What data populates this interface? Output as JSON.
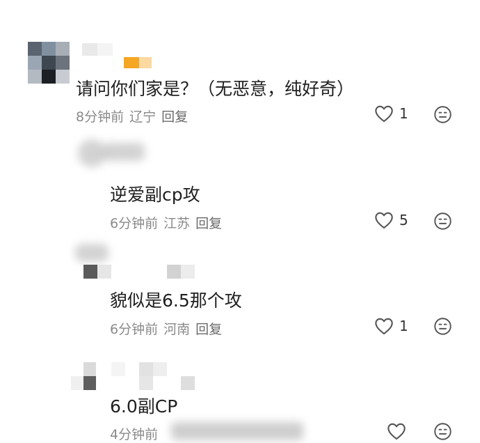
{
  "comments": [
    {
      "content": "请问你们家是？（无恶意，纯好奇）",
      "time": "8分钟前",
      "location": "辽宁",
      "reply_label": "回复",
      "likes": "1"
    },
    {
      "content": "逆爱副cp攻",
      "time": "6分钟前",
      "location": "江苏",
      "reply_label": "回复",
      "likes": "5"
    },
    {
      "content": "貌似是6.5那个攻",
      "time": "6分钟前",
      "location": "河南",
      "reply_label": "回复",
      "likes": "1"
    },
    {
      "content": "6.0副CP",
      "time": "4分钟前",
      "location": "",
      "reply_label": "",
      "likes": ""
    }
  ],
  "colors": {
    "text": "#1f1f1f",
    "meta": "#8a8a8a",
    "icon": "#555555",
    "accent_badge": "#f5a623"
  },
  "icons": [
    "heart-outline-icon",
    "emoji-face-icon"
  ]
}
